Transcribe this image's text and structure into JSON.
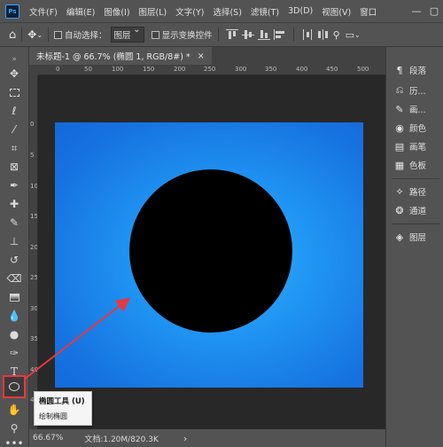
{
  "app": {
    "logo": "Ps"
  },
  "menubar": {
    "items": [
      "文件(F)",
      "编辑(E)",
      "图像(I)",
      "图层(L)",
      "文字(Y)",
      "选择(S)",
      "滤镜(T)",
      "3D(D)",
      "视图(V)",
      "窗口"
    ],
    "window_controls": [
      "—",
      "▢"
    ]
  },
  "options": {
    "auto_select_label": "自动选择：",
    "auto_select_value": "图层",
    "show_transform_label": "显示变换控件"
  },
  "document": {
    "tab_title": "未标题-1 @ 66.7% (椭圆 1, RGB/8#) *",
    "tab_close": "×"
  },
  "rulers": {
    "top": [
      "0",
      "50",
      "100",
      "150",
      "200",
      "250",
      "300",
      "350",
      "400",
      "450",
      "500"
    ],
    "left": [
      "0",
      "5",
      "10",
      "15",
      "20",
      "25",
      "30",
      "35",
      "40",
      "45"
    ]
  },
  "tooltip": {
    "title": "椭圆工具 (U)",
    "description": "绘制椭圆"
  },
  "statusbar": {
    "zoom": "66.67%",
    "doc_info": "文档:1.20M/820.3K",
    "arrow": "›"
  },
  "panels": [
    {
      "icon": "paragraph-icon",
      "glyph": "¶",
      "label": "段落"
    },
    {
      "icon": "history-icon",
      "glyph": "⎌",
      "label": "历..."
    },
    {
      "icon": "brush-icon",
      "glyph": "✎",
      "label": "画..."
    },
    {
      "icon": "color-icon",
      "glyph": "◉",
      "label": "颜色"
    },
    {
      "icon": "swatches-icon",
      "glyph": "▤",
      "label": "画笔"
    },
    {
      "icon": "channels-color-icon",
      "glyph": "▦",
      "label": "色板"
    },
    {
      "icon": "paths-icon",
      "glyph": "⟡",
      "label": "路径"
    },
    {
      "icon": "channels-icon",
      "glyph": "❂",
      "label": "通道"
    },
    {
      "icon": "layers-icon",
      "glyph": "◈",
      "label": "图层"
    }
  ],
  "colors": {
    "accent_highlight": "#e8383d",
    "canvas_blue": "#1f93f2",
    "shape": "#000000"
  }
}
